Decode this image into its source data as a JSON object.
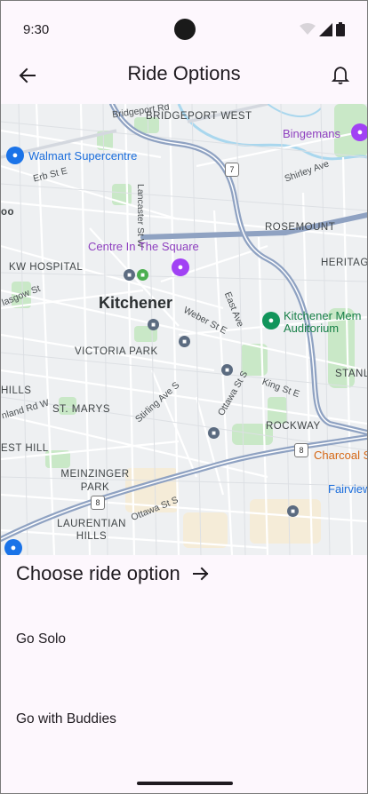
{
  "status_bar": {
    "time": "9:30"
  },
  "app_bar": {
    "title": "Ride Options",
    "back_icon": "arrow-left-icon",
    "notification_icon": "bell-icon"
  },
  "map": {
    "areas": [
      "BRIDGEPORT WEST",
      "ROSEMOUNT",
      "HERITAG",
      "KW HOSPITAL",
      "VICTORIA PARK",
      "HILLS",
      "ST. MARYS",
      "EST HILL",
      "MEINZINGER PARK",
      "LAURENTIAN HILLS",
      "ROCKWAY",
      "STANL",
      "oo"
    ],
    "city": "Kitchener",
    "streets": [
      "Bridgeport Rd",
      "Erb St E",
      "Lancaster St W",
      "Shirley Ave",
      "lasgow St",
      "Weber St E",
      "East Ave",
      "King St E",
      "Stirling Ave S",
      "Ottawa St S",
      "nland Rd W",
      "Ottawa St S"
    ],
    "pois": {
      "walmart": "Walmart Supercentre",
      "bingemans": "Bingemans",
      "centre": "Centre In The Square",
      "auditorium_line1": "Kitchener Mem",
      "auditorium_line2": "Auditorium",
      "charcoal": "Charcoal S",
      "fairview": "Fairview"
    },
    "highway_shields": [
      "7",
      "8",
      "8"
    ]
  },
  "section": {
    "choose_label": "Choose ride option",
    "arrow_icon": "arrow-right-icon"
  },
  "options": [
    {
      "label": "Go Solo"
    },
    {
      "label": "Go with Buddies"
    }
  ],
  "colors": {
    "background": "#fdf7fd",
    "text": "#1f1b20",
    "highway": "#8da1c3",
    "park": "#c8e9c6"
  }
}
